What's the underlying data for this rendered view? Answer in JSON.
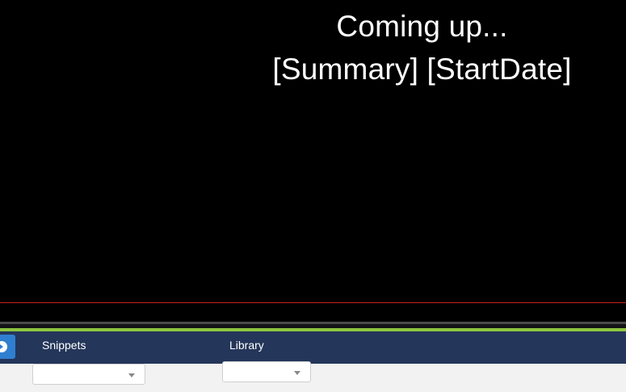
{
  "slide": {
    "heading_line1": "Coming up...",
    "heading_line2": "[Summary] [StartDate]"
  },
  "toolbar": {
    "snippets_label": "Snippets",
    "snippets_value": "",
    "library_label": "Library",
    "library_value": "",
    "side_button_icon": "circle-arrow-right-icon"
  },
  "colors": {
    "stage_bg": "#000000",
    "divider_red": "#c81e1e",
    "accent_green": "#8dc63f",
    "toolbar_bg": "#24365a",
    "button_blue": "#2f7fd0",
    "footer_bg": "#f2f2f2"
  }
}
